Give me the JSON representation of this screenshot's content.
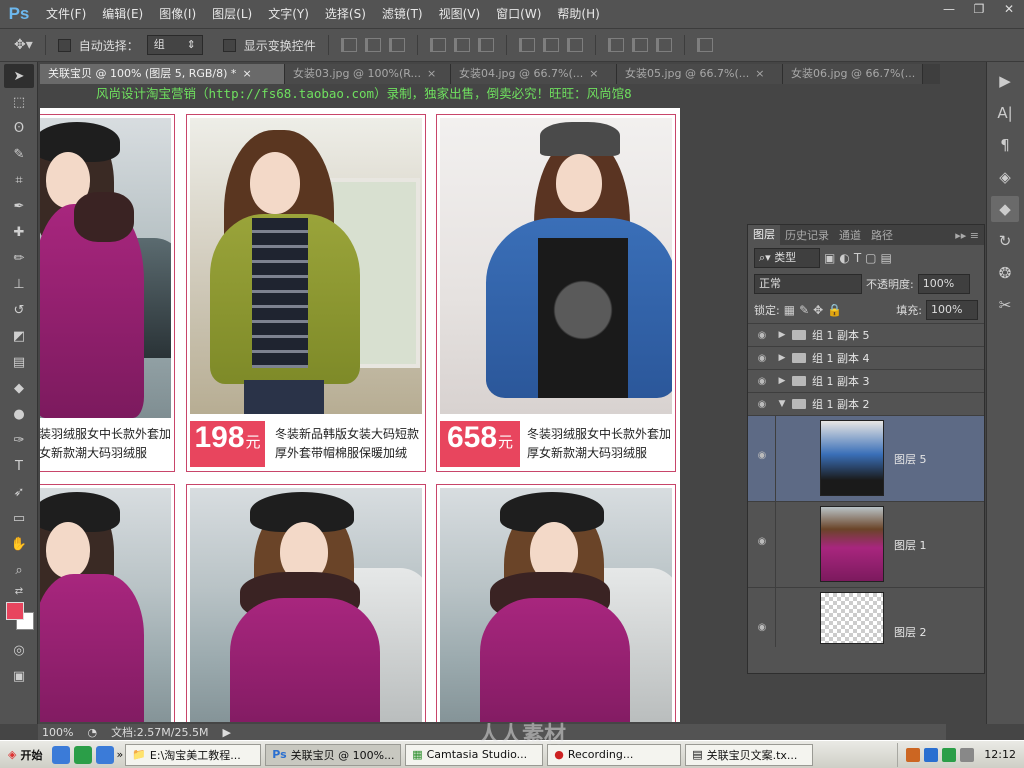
{
  "app": {
    "logo": "Ps"
  },
  "menu": [
    "文件(F)",
    "编辑(E)",
    "图像(I)",
    "图层(L)",
    "文字(Y)",
    "选择(S)",
    "滤镜(T)",
    "视图(V)",
    "窗口(W)",
    "帮助(H)"
  ],
  "window_controls": {
    "minimize": "—",
    "restore": "❐",
    "close": "✕"
  },
  "options": {
    "auto_select_label": "自动选择：",
    "auto_select_value": "组",
    "show_transform_label": "显示变换控件"
  },
  "tabs": [
    {
      "label": "关联宝贝 @ 100% (图层 5, RGB/8) *",
      "close": "×"
    },
    {
      "label": "女装03.jpg @ 100%(R...",
      "close": "×"
    },
    {
      "label": "女装04.jpg @ 66.7%(...",
      "close": "×"
    },
    {
      "label": "女装05.jpg @ 66.7%(...",
      "close": "×"
    },
    {
      "label": "女装06.jpg @ 66.7%(...",
      "close": "×"
    }
  ],
  "canvas": {
    "banner": "风尚设计淘宝营销（http://fs68.taobao.com）录制，独家出售，倒卖必究！旺旺：风尚馆8",
    "products": [
      {
        "price": "198",
        "unit": "元",
        "desc_line1": "冬装新品韩版女装大码短款",
        "desc_line2": "厚外套带帽棉服保暖加绒"
      },
      {
        "price": "658",
        "unit": "元",
        "desc_line1": "冬装羽绒服女中长款外套加",
        "desc_line2": "厚女新款潮大码羽绒服"
      }
    ],
    "left_partial_desc_line1": "装羽绒服女中长款外套加",
    "left_partial_desc_line2": "女新款潮大码羽绒服"
  },
  "layers_panel": {
    "tabs": [
      "图层",
      "历史记录",
      "通道",
      "路径"
    ],
    "filter": "类型",
    "blend_mode": "正常",
    "opacity_label": "不透明度:",
    "opacity": "100%",
    "lock_label": "锁定:",
    "fill_label": "填充:",
    "fill": "100%",
    "layers": [
      {
        "name": "组 1 副本 5",
        "type": "group",
        "expanded": false
      },
      {
        "name": "组 1 副本 4",
        "type": "group",
        "expanded": false
      },
      {
        "name": "组 1 副本 3",
        "type": "group",
        "expanded": false
      },
      {
        "name": "组 1 副本 2",
        "type": "group",
        "expanded": true
      },
      {
        "name": "图层 5",
        "type": "layer",
        "selected": true
      },
      {
        "name": "图层 1",
        "type": "layer"
      },
      {
        "name": "图层 2",
        "type": "layer"
      }
    ]
  },
  "status": {
    "zoom": "100%",
    "doc": "文档:2.57M/25.5M"
  },
  "taskbar": {
    "start": "开始",
    "buttons": [
      "E:\\淘宝美工教程...",
      "关联宝贝 @ 100%...",
      "Camtasia Studio...",
      "Recording...",
      "关联宝贝文案.tx..."
    ],
    "time": "12:12",
    "watermark": "人人素材"
  },
  "colors": {
    "accent_price": "#e8455e",
    "card_border": "#c8456a",
    "banner_green": "#6fe05f",
    "selected_layer": "#5d6a85"
  }
}
